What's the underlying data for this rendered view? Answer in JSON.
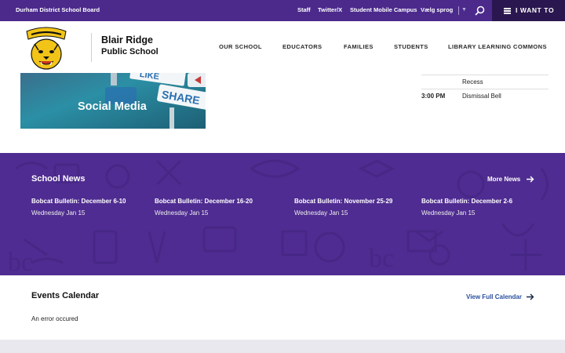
{
  "topbar": {
    "district": "Durham District School Board",
    "links": [
      "Staff",
      "Twitter/X",
      "Student Mobile Campus",
      "Vælg sprog"
    ],
    "i_want_to": "I WANT TO"
  },
  "header": {
    "school_line1": "Blair Ridge",
    "school_line2": "Public School",
    "nav": [
      "OUR SCHOOL",
      "EDUCATORS",
      "FAMILIES",
      "STUDENTS",
      "LIBRARY LEARNING COMMONS"
    ]
  },
  "social": {
    "title": "Social Media"
  },
  "bell": {
    "rows": [
      {
        "time": "",
        "label": "Recess"
      },
      {
        "time": "3:00 PM",
        "label": "Dismissal Bell"
      }
    ]
  },
  "news": {
    "title": "School News",
    "more": "More News",
    "items": [
      {
        "title": "Bobcat Bulletin: December 6-10",
        "date": "Wednesday Jan 15"
      },
      {
        "title": "Bobcat Bulletin: December 16-20",
        "date": "Wednesday Jan 15"
      },
      {
        "title": "Bobcat Bulletin: November 25-29",
        "date": "Wednesday Jan 15"
      },
      {
        "title": "Bobcat Bulletin: December 2-6",
        "date": "Wednesday Jan 15"
      }
    ]
  },
  "events": {
    "title": "Events Calendar",
    "link": "View Full Calendar",
    "message": "An error occured"
  },
  "colors": {
    "brand_purple": "#4b2a8c",
    "dark_purple": "#2b174f",
    "link_blue": "#2a4f9e"
  }
}
